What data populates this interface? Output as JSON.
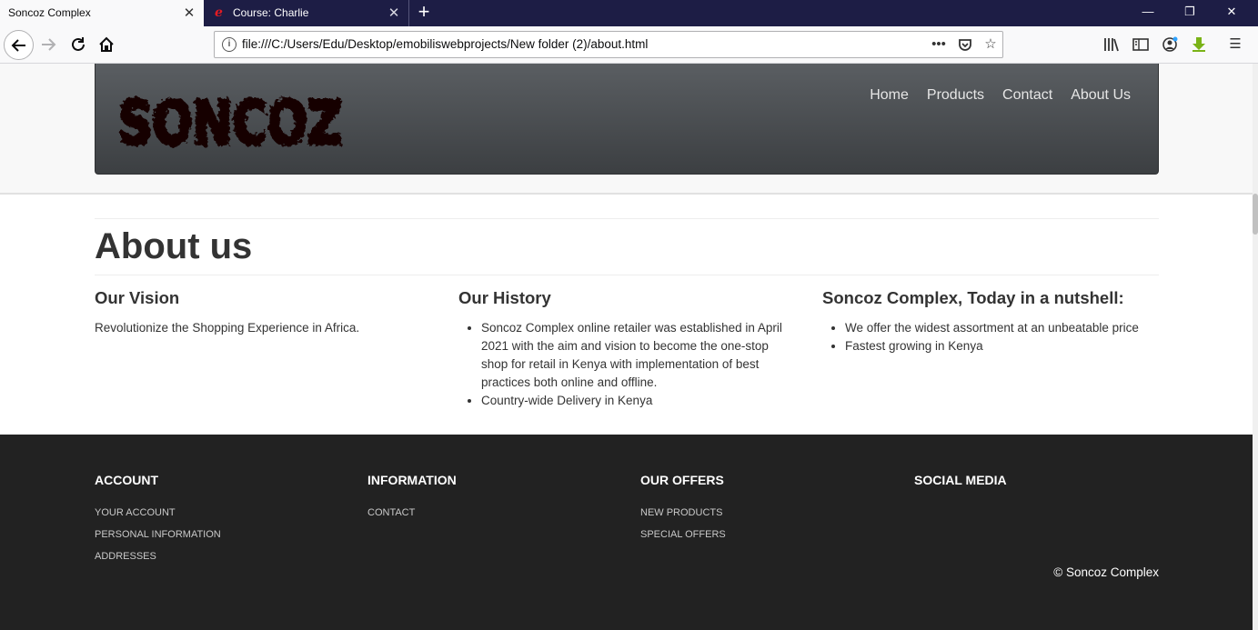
{
  "browser": {
    "tabs": [
      {
        "title": "Soncoz Complex",
        "active": true
      },
      {
        "title": "Course: Charlie",
        "active": false
      }
    ],
    "url": "file:///C:/Users/Edu/Desktop/emobiliswebprojects/New folder (2)/about.html",
    "icons": [
      "back-icon",
      "forward-icon",
      "reload-icon",
      "home-icon",
      "info-icon",
      "more-icon",
      "pocket-icon",
      "bookmark-star-icon",
      "library-icon",
      "sidebar-icon",
      "account-icon",
      "download-icon",
      "menu-icon"
    ]
  },
  "site": {
    "logo_text": "SONCOZ",
    "nav": [
      "Home",
      "Products",
      "Contact",
      "About Us"
    ],
    "page_title": "About us",
    "sections": {
      "vision": {
        "heading": "Our Vision",
        "text": "Revolutionize the Shopping Experience in Africa."
      },
      "history": {
        "heading": "Our History",
        "items": [
          "Soncoz Complex online retailer was established in April 2021 with the aim and vision to become the one-stop shop for retail in Kenya with implementation of best practices both online and offline.",
          "Country-wide Delivery in Kenya"
        ]
      },
      "nutshell": {
        "heading": "Soncoz Complex, Today in a nutshell:",
        "items": [
          "We offer the widest assortment at an unbeatable price",
          "Fastest growing in Kenya"
        ]
      }
    },
    "footer": {
      "columns": [
        {
          "heading": "ACCOUNT",
          "links": [
            "YOUR ACCOUNT",
            "PERSONAL INFORMATION",
            "ADDRESSES"
          ]
        },
        {
          "heading": "INFORMATION",
          "links": [
            "CONTACT"
          ]
        },
        {
          "heading": "OUR OFFERS",
          "links": [
            "NEW PRODUCTS",
            "SPECIAL OFFERS"
          ]
        },
        {
          "heading": "SOCIAL MEDIA",
          "links": []
        }
      ],
      "copyright": "© Soncoz Complex"
    }
  }
}
